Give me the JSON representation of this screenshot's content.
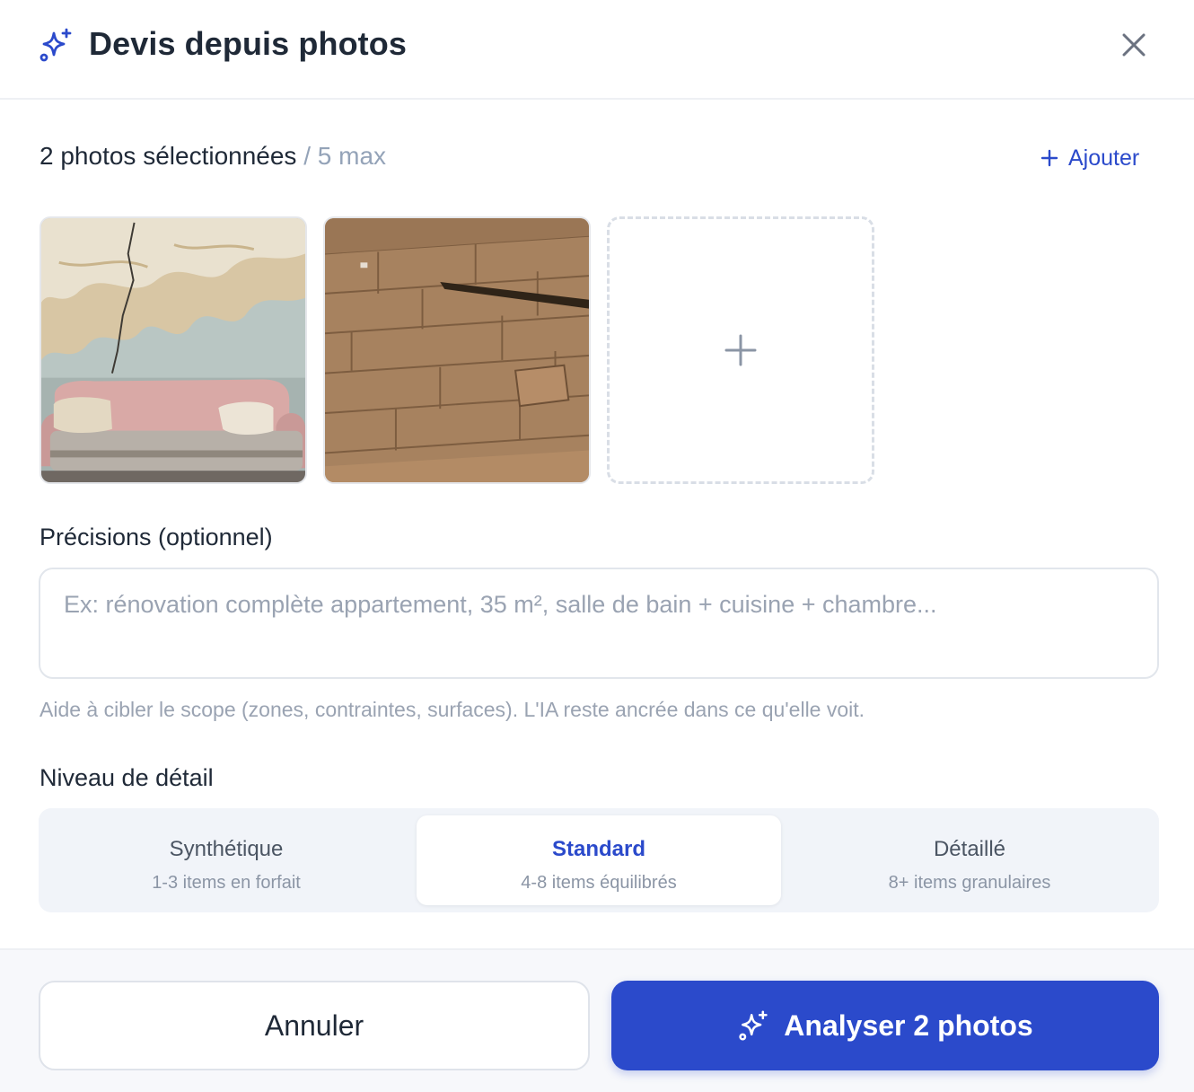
{
  "header": {
    "title": "Devis depuis photos",
    "icon": "sparkles-icon",
    "close_icon": "close-icon"
  },
  "photos": {
    "count_label": "2 photos sélectionnées",
    "max_label": " / 5 max",
    "add_label": "Ajouter",
    "items": [
      {
        "description": "cracked-wall-sofa-photo"
      },
      {
        "description": "damaged-parquet-photo"
      }
    ]
  },
  "precisions": {
    "label": "Précisions (optionnel)",
    "placeholder": "Ex: rénovation complète appartement, 35 m², salle de bain + cuisine + chambre...",
    "help": "Aide à cibler le scope (zones, contraintes, surfaces). L'IA reste ancrée dans ce qu'elle voit."
  },
  "detail_level": {
    "label": "Niveau de détail",
    "selected": "Standard",
    "options": [
      {
        "name": "Synthétique",
        "desc": "1-3 items en forfait"
      },
      {
        "name": "Standard",
        "desc": "4-8 items équilibrés"
      },
      {
        "name": "Détaillé",
        "desc": "8+ items granulaires"
      }
    ]
  },
  "footer": {
    "cancel_label": "Annuler",
    "analyze_label": "Analyser 2 photos"
  },
  "colors": {
    "accent": "#2b4acb",
    "muted_text": "#9aa3b2",
    "segment_bg": "#f1f4f9"
  }
}
